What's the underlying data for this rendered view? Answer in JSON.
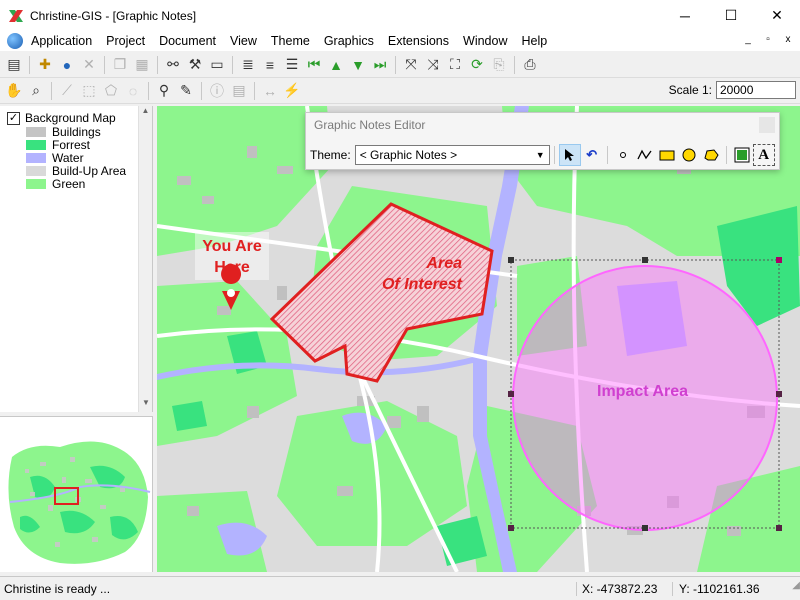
{
  "window": {
    "title": "Christine-GIS - [Graphic Notes]",
    "minimize": "─",
    "maximize": "☐",
    "close": "✕"
  },
  "menu": {
    "items": [
      "Application",
      "Project",
      "Document",
      "View",
      "Theme",
      "Graphics",
      "Extensions",
      "Window",
      "Help"
    ],
    "mdi": [
      "_",
      "▫",
      "x"
    ]
  },
  "toolbar": {
    "row1": [
      "dict",
      "down",
      "globe",
      "x",
      "copy",
      "copy",
      "binoc",
      "tools",
      "page",
      "mirror",
      "mirror",
      "mirror",
      "prev",
      "up",
      "down",
      "next",
      "expand",
      "shrink",
      "fit",
      "refresh",
      "full",
      "print"
    ],
    "row2": [
      "hand",
      "zoom",
      "select",
      "select",
      "select",
      "select",
      "query",
      "edit",
      "info",
      "info",
      "measure",
      "link"
    ],
    "scale_label": "Scale 1:",
    "scale_value": "20000"
  },
  "legend": {
    "group_label": "Background Map",
    "group_checked": "✓",
    "items": [
      {
        "label": "Buildings",
        "color": "#c4c4c4"
      },
      {
        "label": "Forrest",
        "color": "#39e27f"
      },
      {
        "label": "Water",
        "color": "#b3b3ff"
      },
      {
        "label": "Build-Up Area",
        "color": "#d9d9d9"
      },
      {
        "label": "Green",
        "color": "#8df58d"
      }
    ]
  },
  "map": {
    "colors": {
      "green": "#8df58d",
      "forest": "#39e27f",
      "water": "#b3b3ff",
      "buildup": "#dadada",
      "building": "#c0c0c0",
      "road": "#ffffff",
      "aoi": "#e02020",
      "impact": "#ff66ff"
    },
    "you_are_here_line1": "You Are",
    "you_are_here_line2": "Here",
    "aoi_line1": "Area",
    "aoi_line2": "Of Interest",
    "impact_label": "Impact Area"
  },
  "gne": {
    "title": "Graphic Notes Editor",
    "theme_label": "Theme:",
    "theme_value": "< Graphic Notes >",
    "tools": [
      "pointer",
      "undo",
      "point",
      "line",
      "rectangle",
      "circle",
      "polygon",
      "frame",
      "text"
    ]
  },
  "status": {
    "message": "Christine is ready ...",
    "x": "X: -473872.23",
    "y": "Y: -1102161.36"
  }
}
